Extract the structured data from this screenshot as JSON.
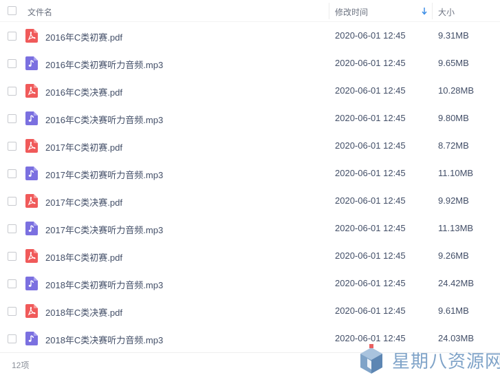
{
  "header": {
    "name_label": "文件名",
    "time_label": "修改时间",
    "size_label": "大小"
  },
  "colors": {
    "pdf_icon": "#f05a5a",
    "audio_icon": "#7b70e0",
    "sort_arrow": "#3d8ee6",
    "watermark": "#7fa3c8"
  },
  "files": [
    {
      "name": "2016年C类初赛.pdf",
      "type": "pdf",
      "modified": "2020-06-01 12:45",
      "size": "9.31MB"
    },
    {
      "name": "2016年C类初赛听力音频.mp3",
      "type": "audio",
      "modified": "2020-06-01 12:45",
      "size": "9.65MB"
    },
    {
      "name": "2016年C类决赛.pdf",
      "type": "pdf",
      "modified": "2020-06-01 12:45",
      "size": "10.28MB"
    },
    {
      "name": "2016年C类决赛听力音频.mp3",
      "type": "audio",
      "modified": "2020-06-01 12:45",
      "size": "9.80MB"
    },
    {
      "name": "2017年C类初赛.pdf",
      "type": "pdf",
      "modified": "2020-06-01 12:45",
      "size": "8.72MB"
    },
    {
      "name": "2017年C类初赛听力音频.mp3",
      "type": "audio",
      "modified": "2020-06-01 12:45",
      "size": "11.10MB"
    },
    {
      "name": "2017年C类决赛.pdf",
      "type": "pdf",
      "modified": "2020-06-01 12:45",
      "size": "9.92MB"
    },
    {
      "name": "2017年C类决赛听力音频.mp3",
      "type": "audio",
      "modified": "2020-06-01 12:45",
      "size": "11.13MB"
    },
    {
      "name": "2018年C类初赛.pdf",
      "type": "pdf",
      "modified": "2020-06-01 12:45",
      "size": "9.26MB"
    },
    {
      "name": "2018年C类初赛听力音频.mp3",
      "type": "audio",
      "modified": "2020-06-01 12:45",
      "size": "24.42MB"
    },
    {
      "name": "2018年C类决赛.pdf",
      "type": "pdf",
      "modified": "2020-06-01 12:45",
      "size": "9.61MB"
    },
    {
      "name": "2018年C类决赛听力音频.mp3",
      "type": "audio",
      "modified": "2020-06-01 12:45",
      "size": "24.03MB"
    }
  ],
  "footer": {
    "count_label": "12项"
  },
  "watermark": {
    "text": "星期八资源网",
    "icon": "cube-logo-icon"
  }
}
